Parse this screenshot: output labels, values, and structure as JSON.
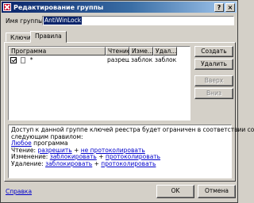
{
  "window": {
    "title": "Редактирование группы",
    "close_glyph": "×",
    "help_glyph": "?"
  },
  "group": {
    "name_label": "Имя группы:",
    "name_value": "AntiWinLock"
  },
  "tabs": [
    {
      "label": "Ключи",
      "active": false
    },
    {
      "label": "Правила",
      "active": true
    }
  ],
  "rules_table": {
    "columns": [
      "Программа",
      "Чтение",
      "Изме...",
      "Удал..."
    ],
    "rows": [
      {
        "checked": true,
        "program": "*",
        "read": "разреш...",
        "modify": "заблок...",
        "delete": "заблок..."
      }
    ]
  },
  "side_buttons": {
    "create": "Создать",
    "delete": "Удалить",
    "up": "Вверх",
    "down": "Вниз"
  },
  "description": {
    "line1": "Доступ к данной группе ключей реестра будет ограничен в соответствии со",
    "line2": "следующим правилом:",
    "any_program": "Любое",
    "program_word": " программа",
    "read_label": "Чтение: ",
    "read_action": "разрешить",
    "read_plus": " + ",
    "read_log": "не протоколировать",
    "modify_label": "Изменение: ",
    "modify_action": "заблокировать",
    "modify_plus": " + ",
    "modify_log": "протоколировать",
    "delete_label": "Удаление: ",
    "delete_action": "заблокировать",
    "delete_plus": " + ",
    "delete_log": "протоколировать"
  },
  "footer": {
    "help_link": "Справка",
    "ok": "OK",
    "cancel": "Отмена"
  }
}
